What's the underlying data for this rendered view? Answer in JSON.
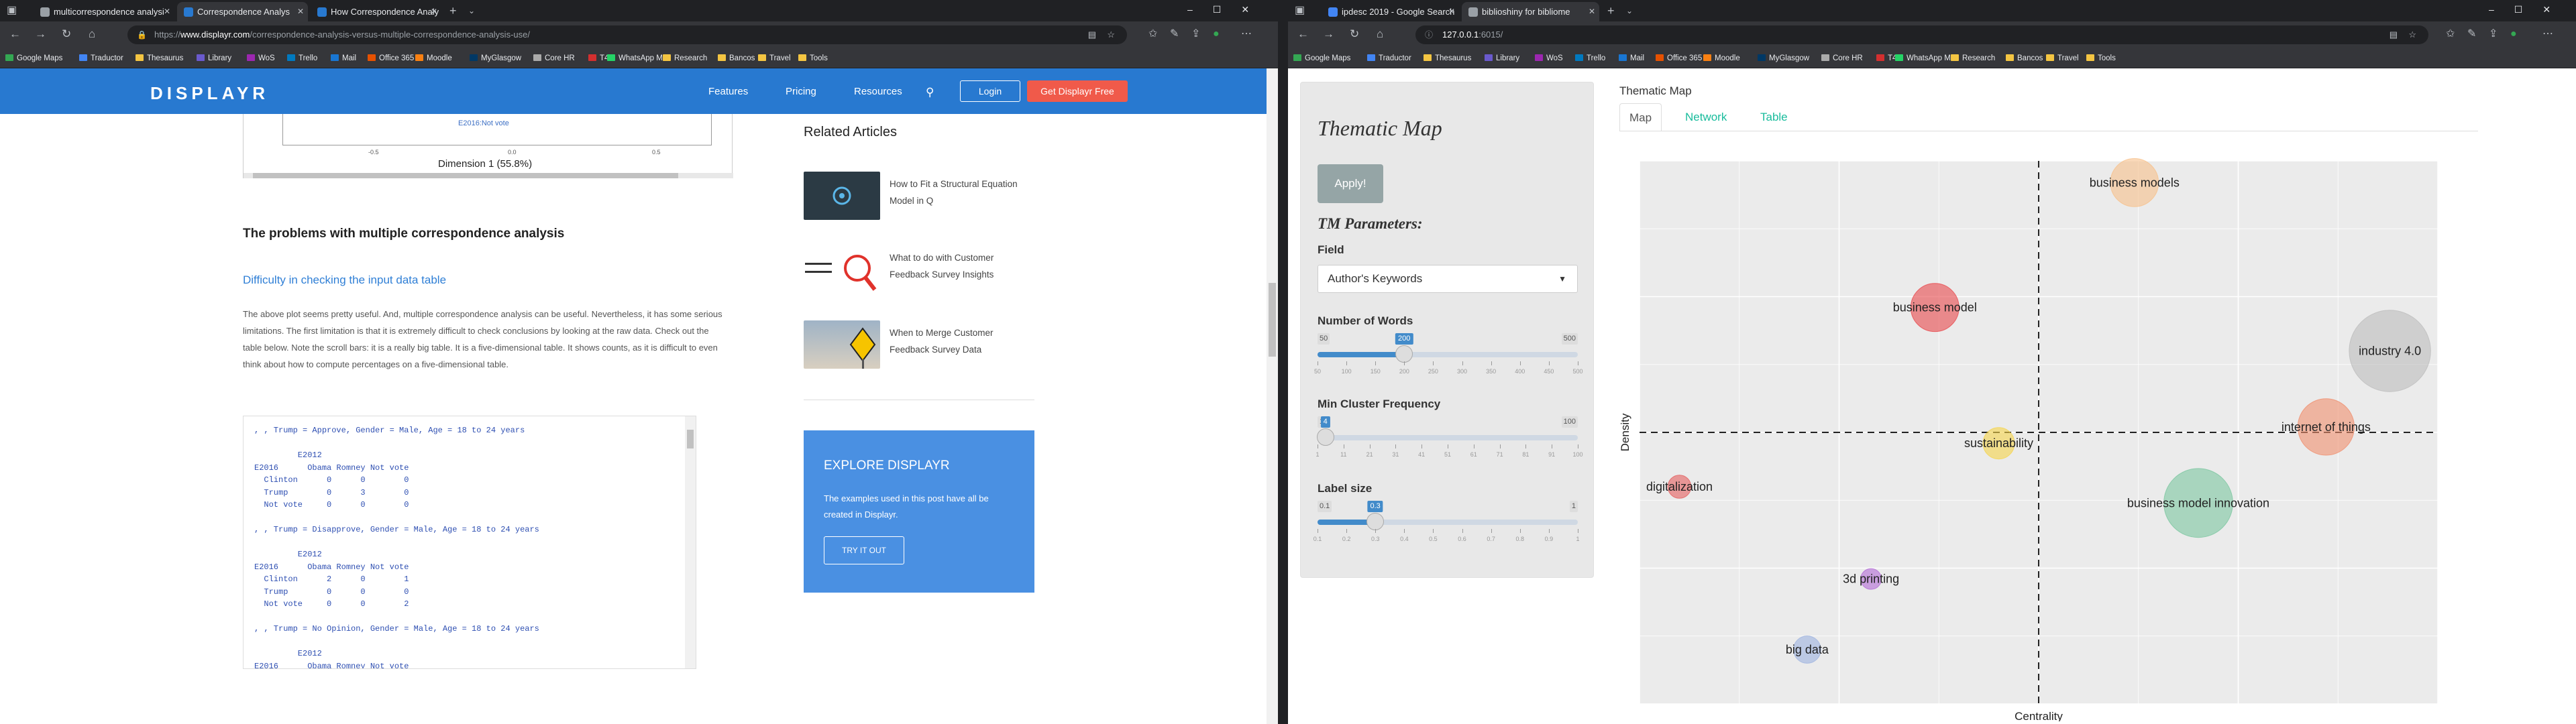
{
  "left_window": {
    "tabs": [
      {
        "title": "multicorrespondence analysi",
        "active": false,
        "favicon_color": "#9aa0a6"
      },
      {
        "title": "Correspondence Analys",
        "active": true,
        "favicon_color": "#2879d0"
      },
      {
        "title": "How Correspondence Analy",
        "active": false,
        "favicon_color": "#2879d0"
      }
    ],
    "url": {
      "scheme": "https://",
      "domain": "www.displayr.com",
      "path": "/correspondence-analysis-versus-multiple-correspondence-analysis-use/"
    },
    "bookmarks": [
      "Google Maps",
      "Traductor",
      "Thesaurus",
      "Library",
      "WoS",
      "Trello",
      "Mail",
      "Office 365",
      "Moodle",
      "MyGlasgow",
      "Core HR",
      "T4",
      "WhatsApp MX",
      "Research",
      "Bancos",
      "Travel",
      "Tools"
    ],
    "header": {
      "logo": "DISPLAYR",
      "nav": [
        "Features",
        "Pricing",
        "Resources"
      ],
      "login": "Login",
      "cta": "Get Displayr Free"
    },
    "chart": {
      "point_label": "E2016:Not vote",
      "ticks": [
        "-0.5",
        "0.0",
        "0.5"
      ],
      "xlabel": "Dimension 1 (55.8%)"
    },
    "article": {
      "heading": "The problems with multiple correspondence analysis",
      "subheading": "Difficulty in checking the input data table",
      "paragraph": "The above plot seems pretty useful. And, multiple correspondence analysis can be useful. Nevertheless, it has some serious limitations. The first limitation is that it is extremely difficult to check conclusions by looking at the raw data. Check out the table below. Note the scroll bars: it is a really big table. It is a five-dimensional table. It shows counts, as it is difficult to even think about how to compute percentages on a five-dimensional table.",
      "code": ", , Trump = Approve, Gender = Male, Age = 18 to 24 years\n\n         E2012\nE2016      Obama Romney Not vote\n  Clinton      0      0        0\n  Trump        0      3        0\n  Not vote     0      0        0\n\n, , Trump = Disapprove, Gender = Male, Age = 18 to 24 years\n\n         E2012\nE2016      Obama Romney Not vote\n  Clinton      2      0        1\n  Trump        0      0        0\n  Not vote     0      0        2\n\n, , Trump = No Opinion, Gender = Male, Age = 18 to 24 years\n\n         E2012\nE2016      Obama Romney Not vote"
    },
    "related": {
      "title": "Related Articles",
      "items": [
        {
          "title": "How to Fit a Structural Equation Model in Q"
        },
        {
          "title": "What to do with Customer Feedback Survey Insights"
        },
        {
          "title": "When to Merge Customer Feedback Survey Data"
        }
      ]
    },
    "explore": {
      "title": "EXPLORE DISPLAYR",
      "desc": "The examples used in this post have all be created in Displayr.",
      "button": "TRY IT OUT"
    }
  },
  "right_window": {
    "tabs": [
      {
        "title": "ipdesc 2019 - Google Search",
        "active": false,
        "favicon_color": "#4285f4"
      },
      {
        "title": "biblioshiny for bibliome",
        "active": true,
        "favicon_color": "#9aa0a6"
      }
    ],
    "url": {
      "scheme": "",
      "domain": "127.0.0.1",
      "path": ":6015/"
    },
    "bookmarks": [
      "Google Maps",
      "Traductor",
      "Thesaurus",
      "Library",
      "WoS",
      "Trello",
      "Mail",
      "Office 365",
      "Moodle",
      "MyGlasgow",
      "Core HR",
      "T4",
      "WhatsApp MX",
      "Research",
      "Bancos",
      "Travel",
      "Tools"
    ],
    "sidebar": {
      "title": "Thematic Map",
      "apply": "Apply!",
      "params_title": "TM Parameters:",
      "field_label": "Field",
      "field_value": "Author's Keywords",
      "sliders": [
        {
          "label": "Number of Words",
          "min": "50",
          "max": "500",
          "value": "200",
          "frac": 0.333,
          "ticks": [
            "50",
            "100",
            "150",
            "200",
            "250",
            "300",
            "350",
            "400",
            "450",
            "500"
          ]
        },
        {
          "label": "Min Cluster Frequency",
          "min": "1",
          "max": "100",
          "value": "4",
          "frac": 0.03,
          "ticks": [
            "1",
            "11",
            "21",
            "31",
            "41",
            "51",
            "61",
            "71",
            "81",
            "91",
            "100"
          ]
        },
        {
          "label": "Label size",
          "min": "0.1",
          "max": "1",
          "value": "0.3",
          "frac": 0.222,
          "ticks": [
            "0.1",
            "0.2",
            "0.3",
            "0.4",
            "0.5",
            "0.6",
            "0.7",
            "0.8",
            "0.9",
            "1"
          ]
        }
      ]
    },
    "main": {
      "heading": "Thematic Map",
      "tabs": [
        "Map",
        "Network",
        "Table"
      ],
      "active_tab": "Map"
    }
  },
  "chart_data": {
    "type": "scatter",
    "title": "",
    "xlabel": "Centrality",
    "ylabel": "Density",
    "xlim": [
      0,
      100
    ],
    "ylim": [
      0,
      100
    ],
    "x_center": 50,
    "y_center": 50,
    "grid": true,
    "points": [
      {
        "label": "business models",
        "x": 62,
        "y": 96,
        "size": 0.45,
        "color": "#f7c08a"
      },
      {
        "label": "business model",
        "x": 37,
        "y": 73,
        "size": 0.45,
        "color": "#e8474b"
      },
      {
        "label": "industry 4.0",
        "x": 94,
        "y": 65,
        "size": 0.85,
        "color": "#bdbdbd"
      },
      {
        "label": "internet of things",
        "x": 86,
        "y": 51,
        "size": 0.55,
        "color": "#f08f6e"
      },
      {
        "label": "sustainability",
        "x": 45,
        "y": 48,
        "size": 0.25,
        "color": "#f5d44a"
      },
      {
        "label": "digitalization",
        "x": 5,
        "y": 40,
        "size": 0.15,
        "color": "#e45e5e"
      },
      {
        "label": "business model innovation",
        "x": 70,
        "y": 37,
        "size": 0.7,
        "color": "#7cc7a0"
      },
      {
        "label": "3d printing",
        "x": 29,
        "y": 23,
        "size": 0.12,
        "color": "#b36bd6"
      },
      {
        "label": "big data",
        "x": 21,
        "y": 10,
        "size": 0.2,
        "color": "#9db3e0"
      }
    ]
  }
}
